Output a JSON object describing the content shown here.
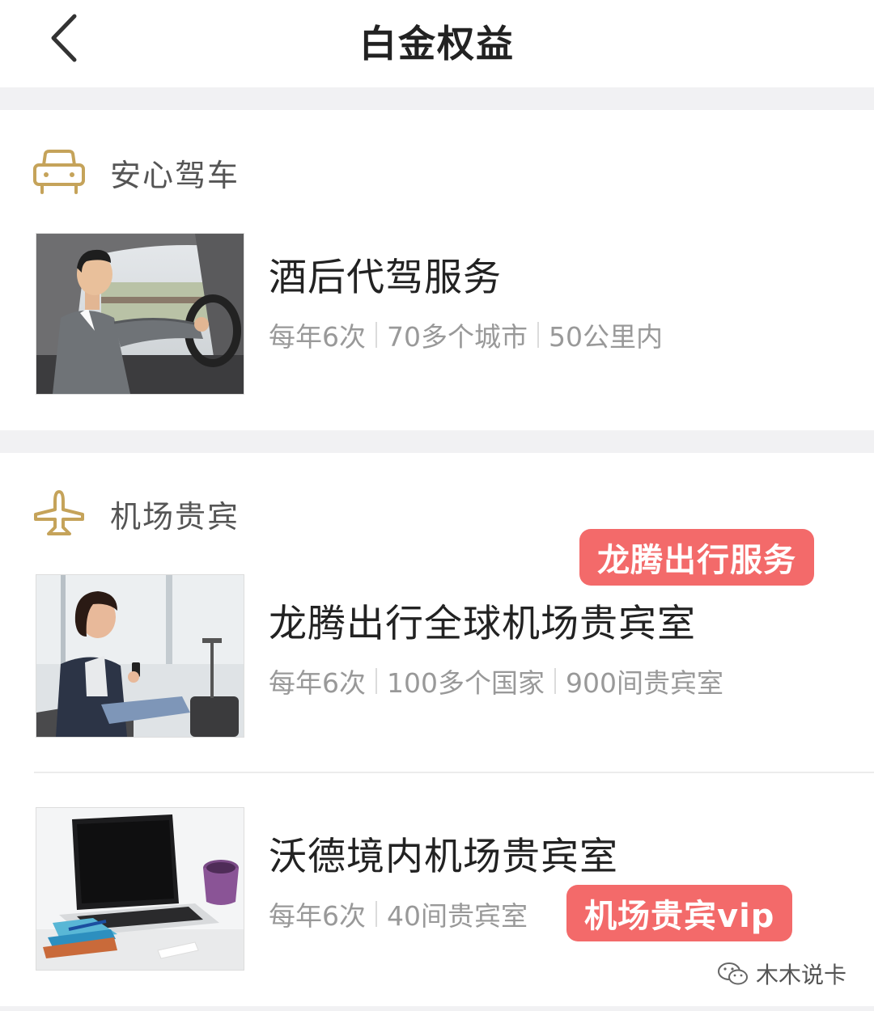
{
  "header": {
    "title": "白金权益"
  },
  "sections": [
    {
      "label": "安心驾车",
      "items": [
        {
          "title": "酒后代驾服务",
          "meta": [
            "每年6次",
            "70多个城市",
            "50公里内"
          ]
        }
      ]
    },
    {
      "label": "机场贵宾",
      "items": [
        {
          "title": "龙腾出行全球机场贵宾室",
          "meta": [
            "每年6次",
            "100多个国家",
            "900间贵宾室"
          ],
          "tag": "龙腾出行服务"
        },
        {
          "title": "沃德境内机场贵宾室",
          "meta": [
            "每年6次",
            "40间贵宾室"
          ],
          "tag": "机场贵宾vip"
        }
      ]
    }
  ],
  "watermark": "木木说卡",
  "colors": {
    "accent_gold": "#c5a35a",
    "tag_red": "#f36a6a"
  }
}
